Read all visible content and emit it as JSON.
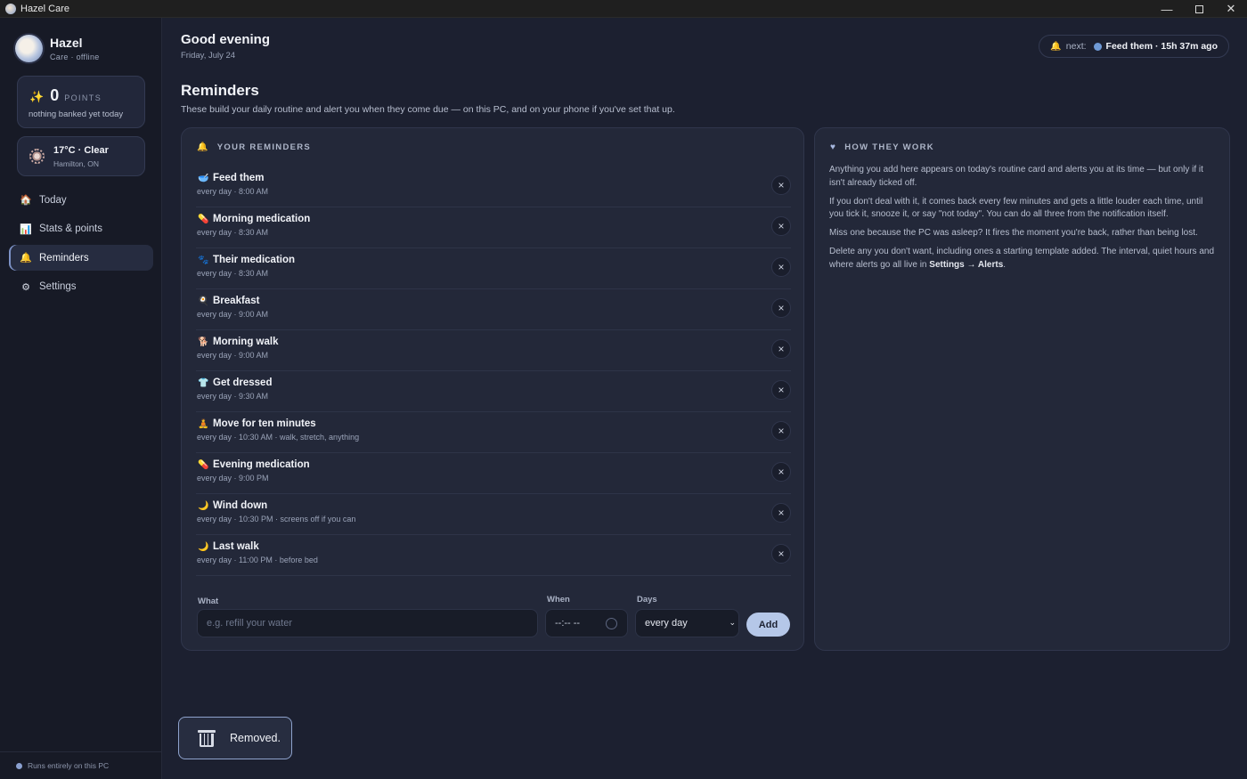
{
  "window": {
    "title": "Hazel Care"
  },
  "brand": {
    "name": "Hazel",
    "status": "Care · offline"
  },
  "points": {
    "value": "0",
    "label": "POINTS",
    "subtext": "nothing banked yet today"
  },
  "weather": {
    "temp": "17°C · Clear",
    "location": "Hamilton, ON"
  },
  "nav": [
    {
      "label": "Today",
      "icon": "home-icon"
    },
    {
      "label": "Stats & points",
      "icon": "chart-icon"
    },
    {
      "label": "Reminders",
      "icon": "bell-icon",
      "active": true
    },
    {
      "label": "Settings",
      "icon": "gear-icon"
    }
  ],
  "footer": {
    "text": "Runs entirely on this PC"
  },
  "header": {
    "greeting": "Good evening",
    "date": "Friday, July 24",
    "next_label": "next:",
    "next_value": "Feed them · 15h 37m ago"
  },
  "page": {
    "title": "Reminders",
    "description": "These build your daily routine and alert you when they come due — on this PC, and on your phone if you've set that up."
  },
  "reminders_panel": {
    "heading": "YOUR REMINDERS",
    "items": [
      {
        "title": "Feed them",
        "sub": "every day · 8:00 AM",
        "icon": "bowl-icon",
        "glyph": "🥣"
      },
      {
        "title": "Morning medication",
        "sub": "every day · 8:30 AM",
        "icon": "pill-icon",
        "glyph": "💊"
      },
      {
        "title": "Their medication",
        "sub": "every day · 8:30 AM",
        "icon": "paw-icon",
        "glyph": "🐾"
      },
      {
        "title": "Breakfast",
        "sub": "every day · 9:00 AM",
        "icon": "plate-icon",
        "glyph": "🍳"
      },
      {
        "title": "Morning walk",
        "sub": "every day · 9:00 AM",
        "icon": "dog-icon",
        "glyph": "🐕"
      },
      {
        "title": "Get dressed",
        "sub": "every day · 9:30 AM",
        "icon": "shirt-icon",
        "glyph": "👕"
      },
      {
        "title": "Move for ten minutes",
        "sub": "every day · 10:30 AM · walk, stretch, anything",
        "icon": "figure-icon",
        "glyph": "🧘"
      },
      {
        "title": "Evening medication",
        "sub": "every day · 9:00 PM",
        "icon": "pill-icon",
        "glyph": "💊"
      },
      {
        "title": "Wind down",
        "sub": "every day · 10:30 PM · screens off if you can",
        "icon": "moon-icon",
        "glyph": "🌙"
      },
      {
        "title": "Last walk",
        "sub": "every day · 11:00 PM · before bed",
        "icon": "moon-icon",
        "glyph": "🌙"
      }
    ],
    "delete_glyph": "×"
  },
  "form": {
    "what_label": "What",
    "what_placeholder": "e.g. refill your water",
    "when_label": "When",
    "when_value": "--:-- --",
    "days_label": "Days",
    "days_value": "every day",
    "add_label": "Add"
  },
  "how_panel": {
    "heading": "HOW THEY WORK",
    "p1": "Anything you add here appears on today's routine card and alerts you at its time — but only if it isn't already ticked off.",
    "p2": "If you don't deal with it, it comes back every few minutes and gets a little louder each time, until you tick it, snooze it, or say \"not today\". You can do all three from the notification itself.",
    "p3": "Miss one because the PC was asleep? It fires the moment you're back, rather than being lost.",
    "p4_pre": "Delete any you don't want, including ones a starting template added. The interval, quiet hours and where alerts go all live in ",
    "p4_link": "Settings → Alerts",
    "p4_post": "."
  },
  "toast": {
    "text": "Removed."
  }
}
